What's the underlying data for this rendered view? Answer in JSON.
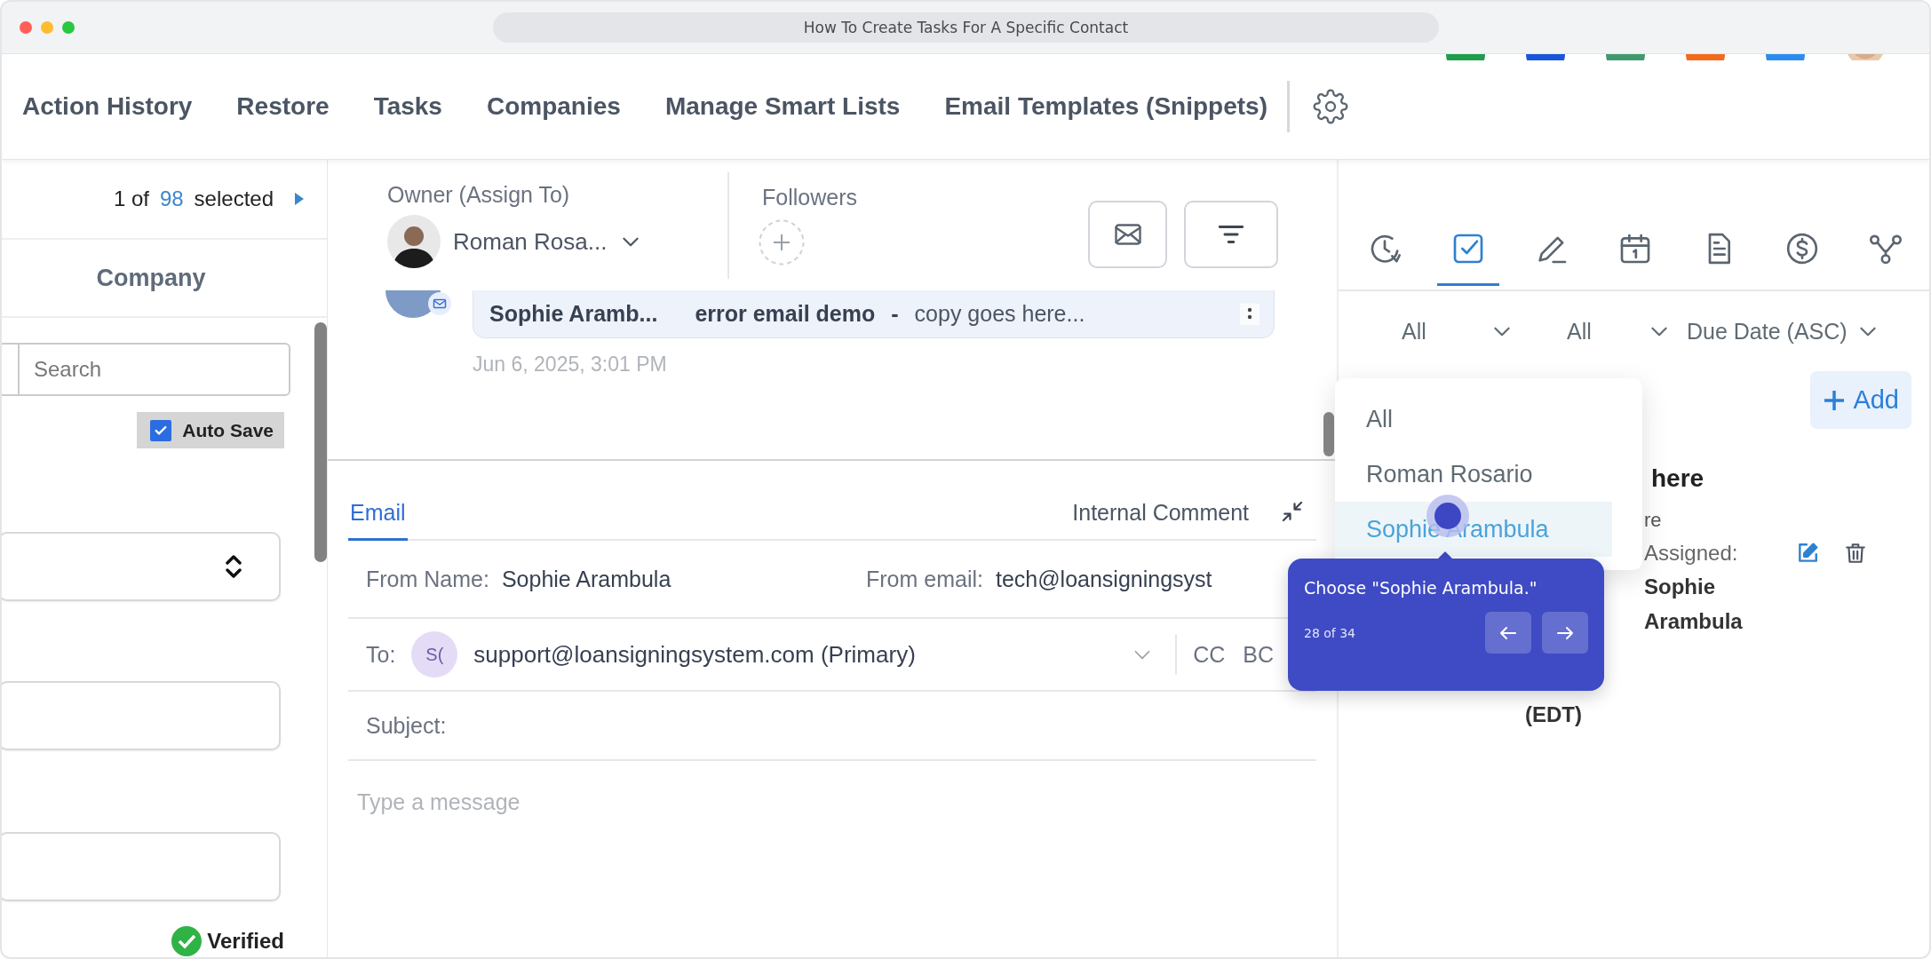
{
  "browser": {
    "title": "How To Create Tasks For A Specific Contact"
  },
  "top_avatars": [
    {
      "color": "#1e9e4a"
    },
    {
      "color": "#1a56db"
    },
    {
      "color": "#3f9b6e"
    },
    {
      "color": "#f26a1b"
    },
    {
      "color": "#2b8cf0"
    },
    {
      "kind": "picture"
    }
  ],
  "nav": {
    "items": [
      "Action History",
      "Restore",
      "Tasks",
      "Companies",
      "Manage Smart Lists",
      "Email Templates (Snippets)"
    ]
  },
  "left": {
    "counter": {
      "current": "1 of",
      "total": "98",
      "suffix": "selected"
    },
    "column_header": "Company",
    "search": {
      "placeholder": "Search"
    },
    "auto_save": {
      "label": "Auto Save",
      "checked": true
    },
    "verified": "Verified"
  },
  "owner": {
    "label": "Owner (Assign To)",
    "name": "Roman Rosa..."
  },
  "followers": {
    "label": "Followers"
  },
  "activity": {
    "sender": "Sophie Aramb...",
    "subject": "error email demo",
    "separator": "-",
    "preview": "copy goes here...",
    "time": "Jun 6, 2025, 3:01 PM"
  },
  "composer": {
    "tabs": [
      {
        "label": "Email",
        "selected": true
      },
      {
        "label": "Internal Comment",
        "selected": false
      }
    ],
    "from_name": {
      "label": "From Name:",
      "value": "Sophie Arambula"
    },
    "from_email": {
      "label": "From email:",
      "value": "tech@loansigningsyst"
    },
    "to": {
      "label": "To:",
      "initials": "S(",
      "value": "support@loansigningsystem.com (Primary)",
      "cc": "CC",
      "bcc": "BC"
    },
    "subject": {
      "label": "Subject:"
    },
    "message": {
      "placeholder": "Type a message"
    }
  },
  "right": {
    "tabs": [
      {
        "kind": "history",
        "selected": false
      },
      {
        "kind": "tasks",
        "selected": true
      },
      {
        "kind": "notes",
        "selected": false
      },
      {
        "kind": "calendar",
        "selected": false
      },
      {
        "kind": "document",
        "selected": false
      },
      {
        "kind": "payments",
        "selected": false
      },
      {
        "kind": "workflow",
        "selected": false
      }
    ],
    "filters": [
      {
        "label": "All"
      },
      {
        "label": "All"
      },
      {
        "label": "Due Date (ASC)"
      }
    ],
    "add_button": "Add",
    "task": {
      "title": "here",
      "line": "re",
      "assigned_label": "Assigned:",
      "assignee": "Sophie Arambula",
      "timezone": "(EDT)"
    }
  },
  "dropdown": {
    "items": [
      {
        "label": "All",
        "selected": false
      },
      {
        "label": "Roman Rosario",
        "selected": false
      },
      {
        "label": "Sophie Arambula",
        "selected": true
      }
    ]
  },
  "tooltip": {
    "text": "Choose \"Sophie Arambula.\"",
    "step": "28 of 34"
  }
}
